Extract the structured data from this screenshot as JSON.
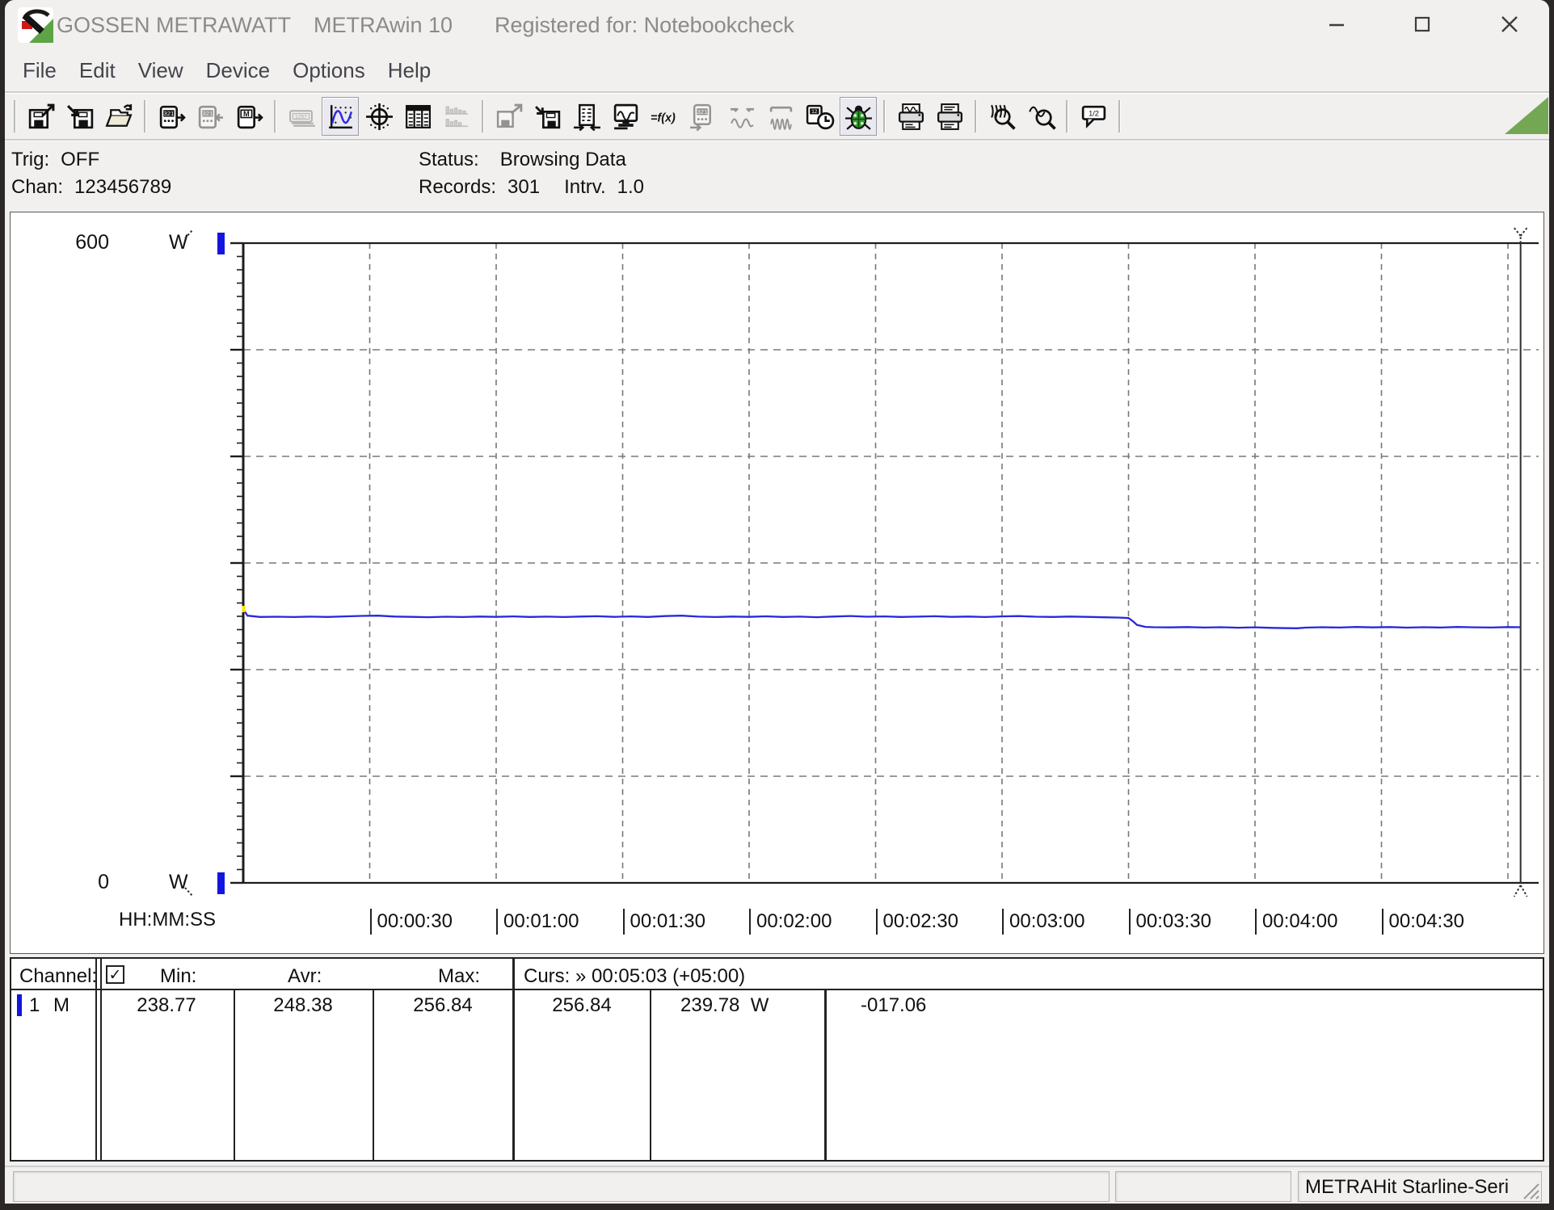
{
  "window": {
    "brand": "GOSSEN METRAWATT",
    "app": "METRAwin 10",
    "registered": "Registered for: Notebookcheck"
  },
  "menu": {
    "items": [
      "File",
      "Edit",
      "View",
      "Device",
      "Options",
      "Help"
    ]
  },
  "toolbar": {
    "groups": [
      [
        {
          "name": "save-export-icon",
          "state": "normal"
        },
        {
          "name": "save-import-icon",
          "state": "normal"
        },
        {
          "name": "open-folder-icon",
          "state": "normal"
        }
      ],
      [
        {
          "name": "device-send-321-icon",
          "state": "normal"
        },
        {
          "name": "device-receive-321-icon",
          "state": "disabled"
        },
        {
          "name": "device-memory-icon",
          "state": "normal"
        }
      ],
      [
        {
          "name": "display-1257-icon",
          "state": "disabled"
        },
        {
          "name": "view-chart-icon",
          "state": "selected"
        },
        {
          "name": "view-xy-icon",
          "state": "normal"
        },
        {
          "name": "view-table-icon",
          "state": "normal"
        },
        {
          "name": "view-histogram-icon",
          "state": "disabled"
        }
      ],
      [
        {
          "name": "disk-copy-icon",
          "state": "disabled"
        },
        {
          "name": "disk-store-icon",
          "state": "normal"
        },
        {
          "name": "column-config-icon",
          "state": "normal"
        },
        {
          "name": "monitor-scope-icon",
          "state": "normal"
        },
        {
          "name": "function-fx-icon",
          "state": "normal"
        },
        {
          "name": "device-321-icon",
          "state": "disabled"
        },
        {
          "name": "probe-wave-icon",
          "state": "disabled"
        },
        {
          "name": "wave-burst-icon",
          "state": "disabled"
        },
        {
          "name": "device-clock-icon",
          "state": "normal"
        },
        {
          "name": "bug-icon",
          "state": "selected"
        }
      ],
      [
        {
          "name": "print-chart-icon",
          "state": "normal"
        },
        {
          "name": "print-list-icon",
          "state": "normal"
        }
      ],
      [
        {
          "name": "zoom-waves-icon",
          "state": "normal"
        },
        {
          "name": "zoom-wave-icon",
          "state": "normal"
        }
      ],
      [
        {
          "name": "note-bubble-icon",
          "state": "normal"
        }
      ]
    ]
  },
  "status_area": {
    "trig_label": "Trig:",
    "trig_value": "OFF",
    "chan_label": "Chan:",
    "chan_value": "123456789",
    "status_label": "Status:",
    "status_value": "Browsing Data",
    "records_label": "Records:",
    "records_value": "301",
    "intrv_label": "Intrv.",
    "intrv_value": "1.0"
  },
  "chart": {
    "y_max_label": "600",
    "y_min_label": "0",
    "y_unit": "W",
    "x_axis_label": "HH:MM:SS",
    "x_ticks": [
      "00:00:30",
      "00:01:00",
      "00:01:30",
      "00:02:00",
      "00:02:30",
      "00:03:00",
      "00:03:30",
      "00:04:00",
      "00:04:30"
    ]
  },
  "chart_data": {
    "type": "line",
    "title": "Power vs time",
    "ylabel": "W",
    "ylim": [
      0,
      600
    ],
    "y_gridline_step": 100,
    "x_unit": "seconds",
    "x_range": [
      0,
      303
    ],
    "x_tick_interval_s": 30,
    "grid": true,
    "series": [
      {
        "name": "Channel 1",
        "unit": "W",
        "color": "#2828dc",
        "points": [
          [
            0,
            256.84
          ],
          [
            1,
            250.6
          ],
          [
            4,
            249.4
          ],
          [
            8,
            249.6
          ],
          [
            12,
            249.3
          ],
          [
            16,
            249.7
          ],
          [
            20,
            249.4
          ],
          [
            24,
            249.9
          ],
          [
            28,
            250.4
          ],
          [
            32,
            250.6
          ],
          [
            36,
            249.8
          ],
          [
            40,
            249.5
          ],
          [
            44,
            249.2
          ],
          [
            48,
            249.6
          ],
          [
            52,
            249.3
          ],
          [
            56,
            249.8
          ],
          [
            60,
            249.5
          ],
          [
            64,
            249.9
          ],
          [
            68,
            249.4
          ],
          [
            72,
            249.7
          ],
          [
            76,
            249.3
          ],
          [
            80,
            249.8
          ],
          [
            84,
            250.1
          ],
          [
            88,
            249.5
          ],
          [
            92,
            249.9
          ],
          [
            96,
            249.4
          ],
          [
            100,
            250.2
          ],
          [
            104,
            250.6
          ],
          [
            108,
            249.7
          ],
          [
            112,
            249.3
          ],
          [
            116,
            249.8
          ],
          [
            120,
            249.5
          ],
          [
            124,
            250.0
          ],
          [
            128,
            249.4
          ],
          [
            132,
            249.7
          ],
          [
            136,
            249.2
          ],
          [
            140,
            249.8
          ],
          [
            144,
            250.3
          ],
          [
            148,
            249.6
          ],
          [
            152,
            249.9
          ],
          [
            156,
            249.4
          ],
          [
            160,
            249.7
          ],
          [
            164,
            250.1
          ],
          [
            168,
            249.5
          ],
          [
            172,
            249.8
          ],
          [
            176,
            249.3
          ],
          [
            180,
            249.9
          ],
          [
            184,
            250.2
          ],
          [
            188,
            249.6
          ],
          [
            192,
            249.4
          ],
          [
            196,
            249.8
          ],
          [
            200,
            249.5
          ],
          [
            204,
            249.1
          ],
          [
            208,
            248.8
          ],
          [
            210,
            248.3
          ],
          [
            211,
            245.5
          ],
          [
            212,
            242.0
          ],
          [
            214,
            240.1
          ],
          [
            216,
            239.8
          ],
          [
            220,
            239.6
          ],
          [
            224,
            239.9
          ],
          [
            228,
            239.5
          ],
          [
            232,
            239.8
          ],
          [
            236,
            239.3
          ],
          [
            240,
            239.7
          ],
          [
            244,
            239.2
          ],
          [
            248,
            238.9
          ],
          [
            250,
            238.77
          ],
          [
            252,
            239.4
          ],
          [
            256,
            239.8
          ],
          [
            260,
            239.5
          ],
          [
            264,
            240.0
          ],
          [
            268,
            239.6
          ],
          [
            272,
            239.9
          ],
          [
            276,
            239.4
          ],
          [
            280,
            239.8
          ],
          [
            284,
            239.5
          ],
          [
            288,
            240.0
          ],
          [
            292,
            239.7
          ],
          [
            296,
            239.5
          ],
          [
            300,
            239.9
          ],
          [
            303,
            239.78
          ]
        ]
      }
    ],
    "cursor": {
      "time": "00:05:03",
      "x_s": 303,
      "value_w": 239.78
    },
    "stats": {
      "min": 238.77,
      "avr": 248.38,
      "max": 256.84
    }
  },
  "table": {
    "header": {
      "channel": "Channel:",
      "checkbox_checked": true,
      "check_glyph": "✓",
      "min": "Min:",
      "avr": "Avr:",
      "max": "Max:",
      "cursor": "Curs: » 00:05:03 (+05:00)"
    },
    "row": {
      "channel_num": "1",
      "channel_mode": "M",
      "min": "238.77",
      "avr": "248.38",
      "max": "256.84",
      "cursor1": "256.84",
      "cursor2": "239.78",
      "cursor2_unit": "W",
      "delta": "-017.06"
    }
  },
  "statusbar": {
    "device_field": "METRAHit Starline-Seri"
  }
}
